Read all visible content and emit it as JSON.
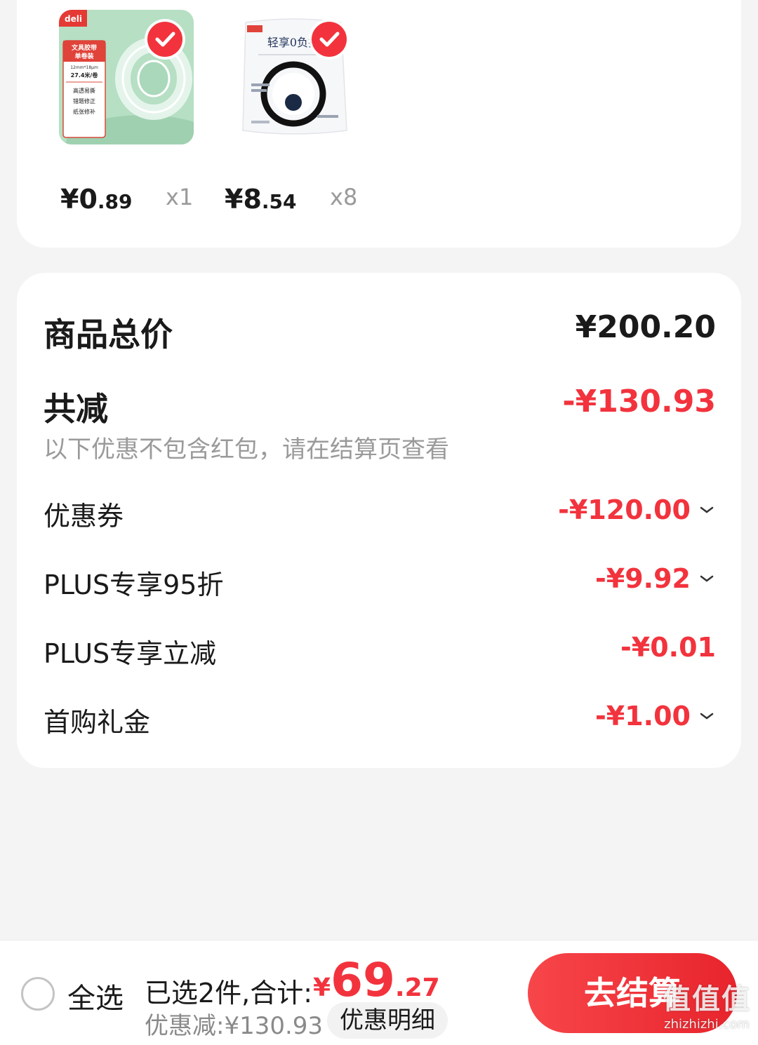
{
  "products": [
    {
      "image": "deli-tape-roll",
      "image_texts": [
        "deli",
        "文具胶带",
        "单卷装",
        "12mm*18μm",
        "27.4米/卷",
        "高透易撕",
        "错题修正",
        "纸张修补"
      ],
      "selected": true,
      "price_int": "¥0",
      "price_dec": ".89",
      "qty": "x1"
    },
    {
      "image": "tissue-pack",
      "image_texts": [
        "轻享0负担"
      ],
      "selected": true,
      "price_int": "¥8",
      "price_dec": ".54",
      "qty": "x8"
    }
  ],
  "summary": {
    "total_label": "商品总价",
    "total_value": "¥200.20",
    "discount_label": "共减",
    "discount_value": "-¥130.93",
    "note": "以下优惠不包含红包，请在结算页查看",
    "items": [
      {
        "label": "优惠券",
        "value": "-¥120.00",
        "expandable": true
      },
      {
        "label": "PLUS专享95折",
        "value": "-¥9.92",
        "expandable": true
      },
      {
        "label": "PLUS专享立减",
        "value": "-¥0.01",
        "expandable": false
      },
      {
        "label": "首购礼金",
        "value": "-¥1.00",
        "expandable": true
      }
    ]
  },
  "bottom": {
    "select_all": "全选",
    "selected_total_label": "已选2件,合计:",
    "total_yen": "¥",
    "total_int": "69",
    "total_dec": ".27",
    "saved": "优惠减:¥130.93",
    "detail_button": "优惠明细",
    "checkout_button": "去结算"
  },
  "watermark": {
    "top": "值值值",
    "bottom": "zhizhizhi.com"
  },
  "colors": {
    "accent": "#f2333d",
    "background": "#f4f4f4",
    "card": "#ffffff",
    "muted": "#9a9a9a"
  }
}
